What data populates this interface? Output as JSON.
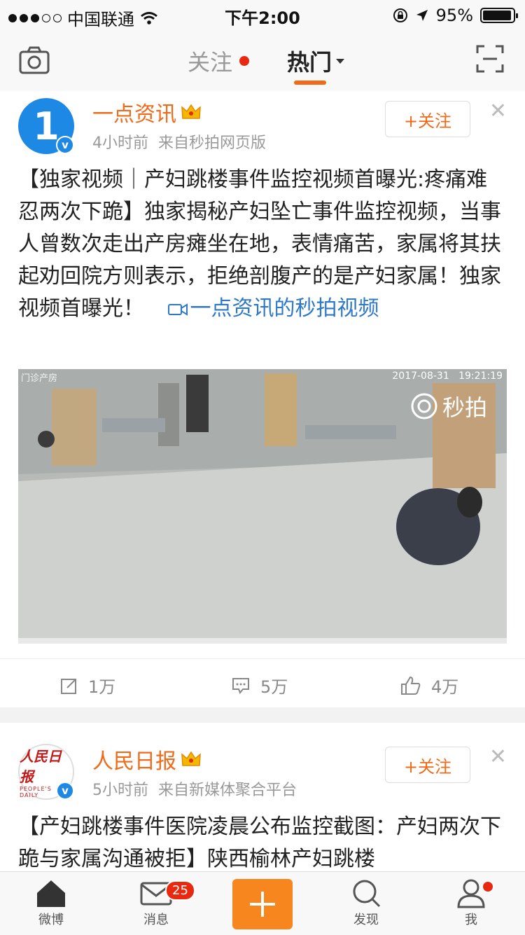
{
  "status_bar": {
    "carrier": "中国联通",
    "time": "下午2:00",
    "battery": "95%",
    "battery_level": 0.95
  },
  "nav": {
    "tab_follow": "关注",
    "tab_hot": "热门",
    "active_tab": "热门"
  },
  "posts": [
    {
      "author": "一点资讯",
      "avatar_text": "1",
      "time": "4小时前",
      "source": "来自秒拍网页版",
      "follow_label": "+关注",
      "text": "【独家视频｜产妇跳楼事件监控视频首曝光:疼痛难忍两次下跪】独家揭秘产妇坠亡事件监控视频，当事人曾数次走出产房瘫坐在地，表情痛苦，家属将其扶起劝回院方则表示，拒绝剖腹产的是产妇家属！独家视频首曝光！",
      "link_text": "一点资讯的秒拍视频",
      "video": {
        "timestamp": "2017-08-31",
        "time": "19:21:19",
        "watermark": "秒拍",
        "corner_label": "门诊产房"
      },
      "stats": {
        "repost": "1万",
        "comment": "5万",
        "like": "4万"
      }
    },
    {
      "author": "人民日报",
      "avatar_cn": "人民日报",
      "avatar_en": "PEOPLE'S DAILY",
      "time": "5小时前",
      "source": "来自新媒体聚合平台",
      "follow_label": "+关注",
      "text": "【产妇跳楼事件医院凌晨公布监控截图：产妇两次下跪与家属沟通被拒】陕西榆林产妇跳楼"
    }
  ],
  "tabbar": {
    "home": "微博",
    "messages": "消息",
    "messages_badge": "25",
    "discover": "发现",
    "me": "我"
  },
  "colors": {
    "accent": "#f06a1a",
    "link": "#2d78c8",
    "badge_red": "#e8280f",
    "plus_orange": "#f7861f"
  }
}
